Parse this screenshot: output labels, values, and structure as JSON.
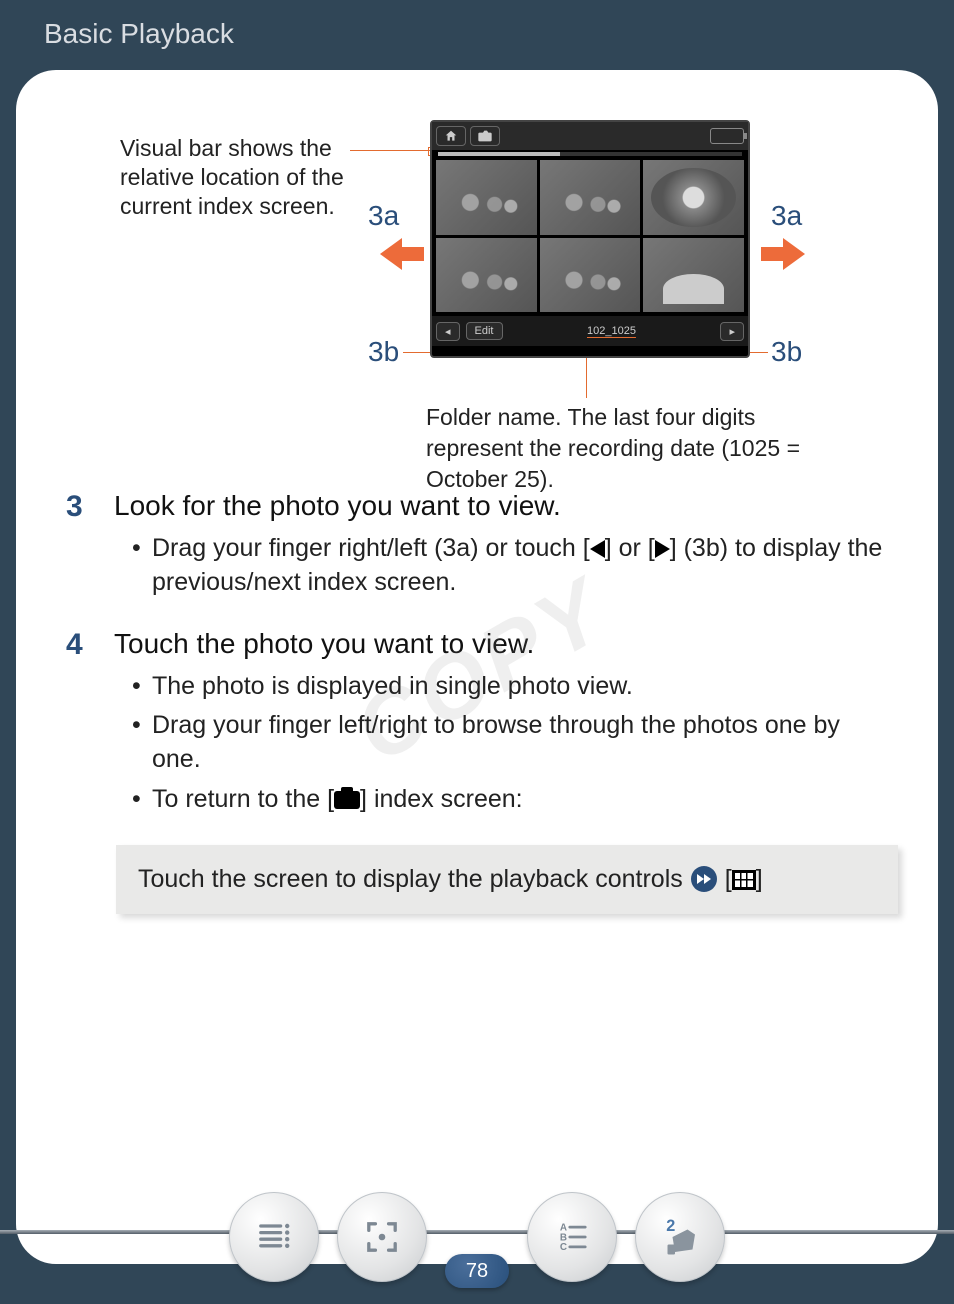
{
  "header": {
    "title": "Basic Playback"
  },
  "diagram": {
    "callout_top": "Visual bar shows the relative loca­tion of the cur­rent index screen.",
    "label_3a": "3a",
    "label_3b": "3b",
    "device": {
      "edit_label": "Edit",
      "folder_name": "102_1025"
    },
    "callout_folder": "Folder name. The last four digits represent the recording date (1025 = October 25)."
  },
  "watermark": "COPY",
  "steps": [
    {
      "num": "3",
      "title": "Look for the photo you want to view.",
      "bullets": [
        {
          "pre": "Drag your finger right/left (3a) or touch [",
          "icon1": "tri-left",
          "mid": "] or [",
          "icon2": "tri-right",
          "post": "] (3b) to display the previous/next index screen."
        }
      ]
    },
    {
      "num": "4",
      "title": "Touch the photo you want to view.",
      "bullets": [
        {
          "text": "The photo is displayed in single photo view."
        },
        {
          "text": "Drag your finger left/right to browse through the photos one by one."
        },
        {
          "pre": "To return to the [",
          "icon1": "camera",
          "post": "] index screen:"
        }
      ]
    }
  ],
  "greybox": {
    "text": "Touch the screen to display the playback controls",
    "bracket_open": "[",
    "bracket_close": "]"
  },
  "footer": {
    "page": "78"
  }
}
